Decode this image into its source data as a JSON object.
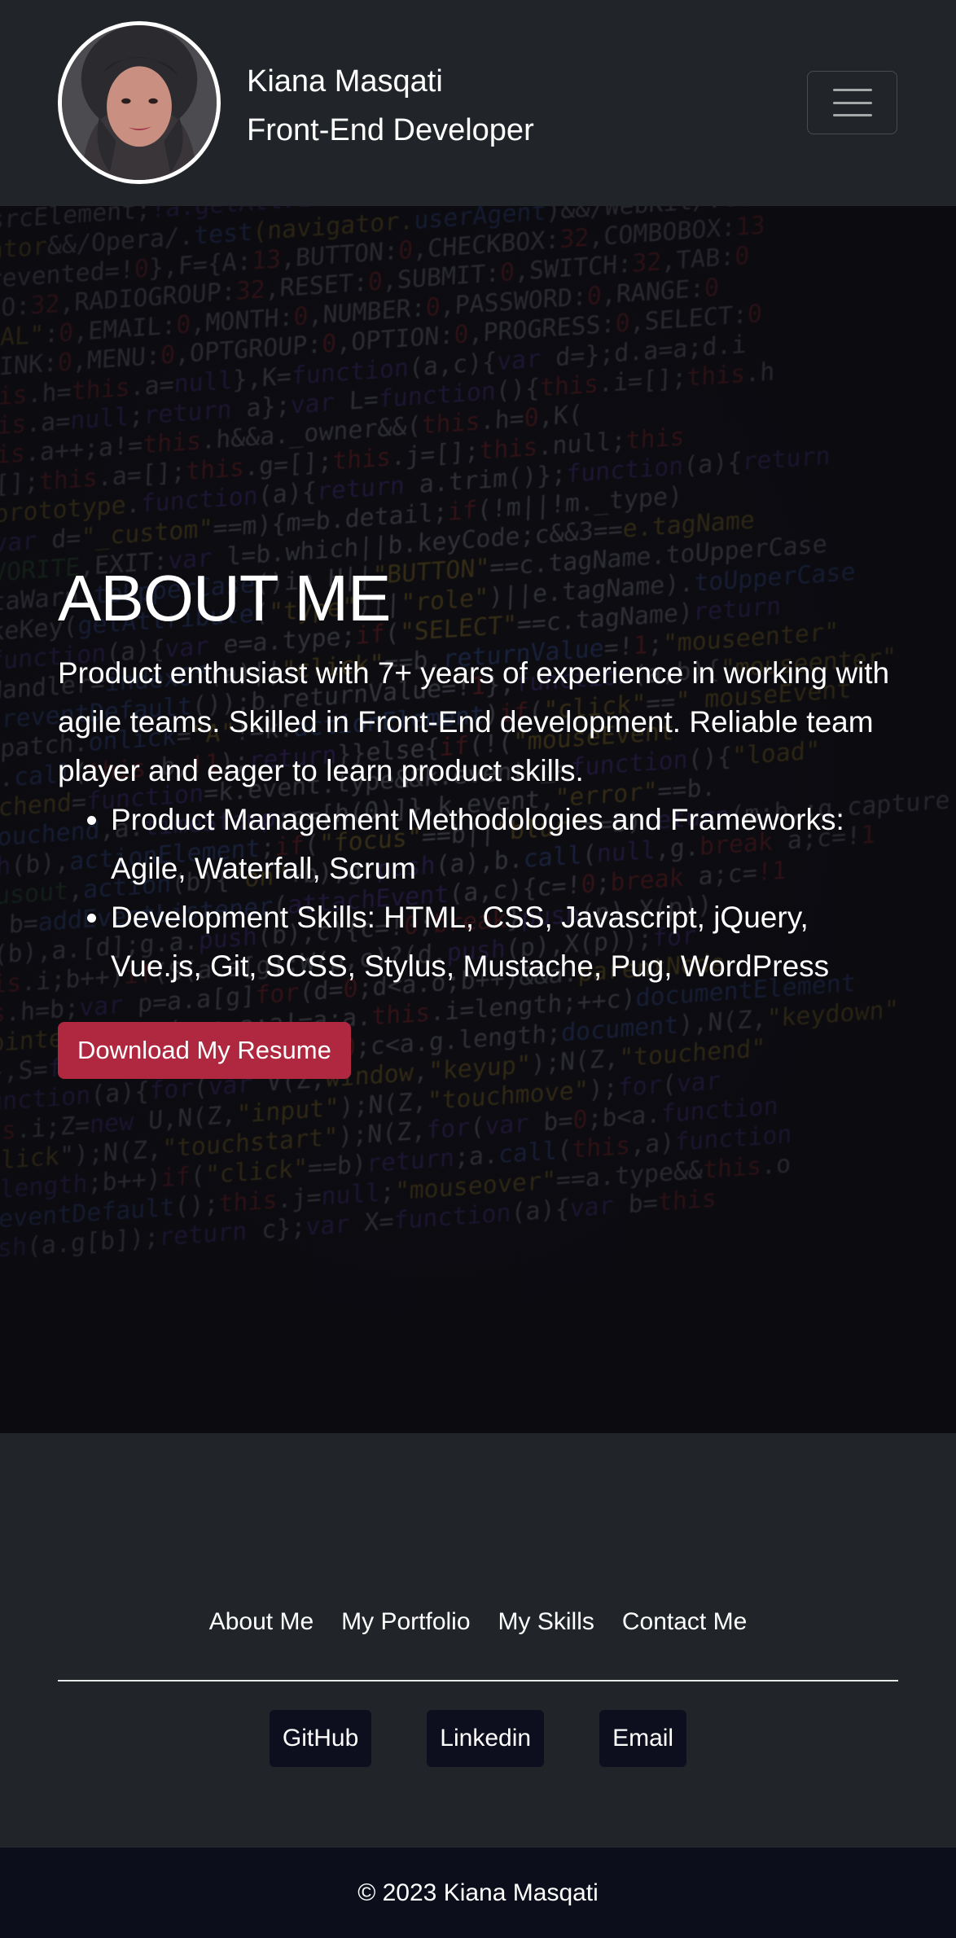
{
  "header": {
    "name": "Kiana Masqati",
    "role": "Front-End Developer"
  },
  "about": {
    "title": "ABOUT ME",
    "intro": "Product enthusiast with 7+ years of experience in working with agile teams. Skilled in Front-End development. Reliable team player and eager to learn product skills.",
    "skills": [
      "Product Management Methodologies and Frameworks: Agile, Waterfall, Scrum",
      "Development Skills: HTML, CSS, Javascript, jQuery, Vue.js, Git, SCSS, Stylus, Mustache, Pug, WordPress"
    ],
    "resume_button": "Download My Resume"
  },
  "footer": {
    "nav": [
      "About Me",
      "My Portfolio",
      "My Skills",
      "Contact Me"
    ],
    "social": [
      "GitHub",
      "Linkedin",
      "Email"
    ],
    "copyright": "© 2023 Kiana Masqati"
  },
  "colors": {
    "background": "#212529",
    "resume_button": "#b0283f",
    "social_button": "#0d0f1e",
    "copyright_bar": "#0c0e1c"
  },
  "icons": {
    "menu": "hamburger-icon",
    "avatar": "profile-photo"
  }
}
